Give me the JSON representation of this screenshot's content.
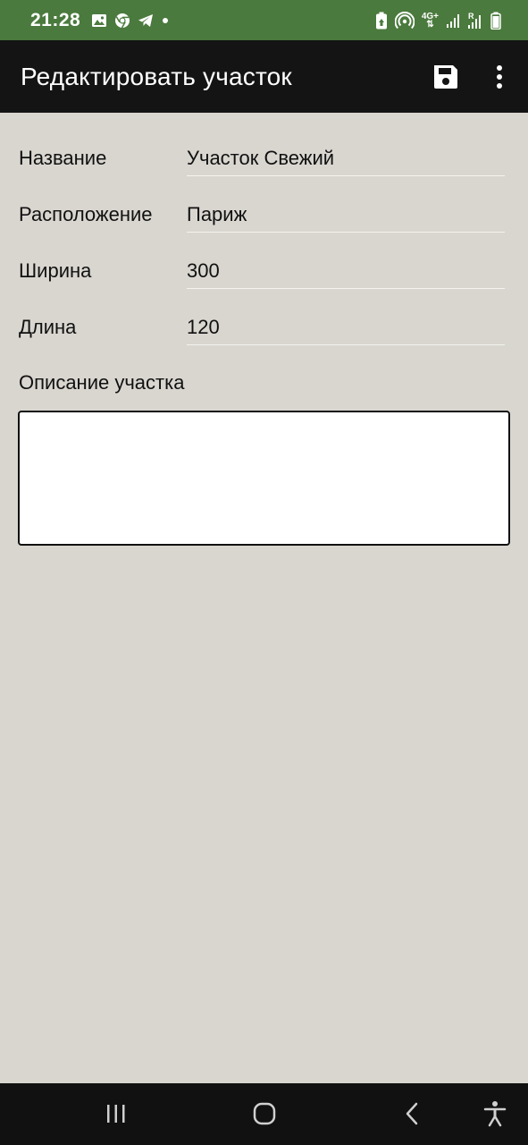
{
  "status_bar": {
    "time": "21:28",
    "network_type": "4G+",
    "roaming": "R",
    "icons": [
      "image-icon",
      "chrome-icon",
      "telegram-icon",
      "dot-icon",
      "battery-saver-icon",
      "hotspot-icon",
      "signal-icon",
      "signal-roaming-icon",
      "battery-icon"
    ]
  },
  "app_bar": {
    "title": "Редактировать участок",
    "save_icon": "save-icon",
    "more_icon": "more-vert-icon"
  },
  "form": {
    "fields": [
      {
        "label": "Название",
        "value": "Участок Свежий"
      },
      {
        "label": "Расположение",
        "value": "Париж"
      },
      {
        "label": "Ширина",
        "value": "300"
      },
      {
        "label": "Длина",
        "value": "120"
      }
    ],
    "description_label": "Описание участка",
    "description_value": ""
  },
  "nav_bar": {
    "icons": [
      "recent-apps-icon",
      "home-icon",
      "back-icon",
      "accessibility-icon"
    ]
  },
  "colors": {
    "status_bar": "#4a7a3d",
    "app_bar": "#141414",
    "background": "#d9d6d0",
    "nav_bar": "#111111"
  }
}
